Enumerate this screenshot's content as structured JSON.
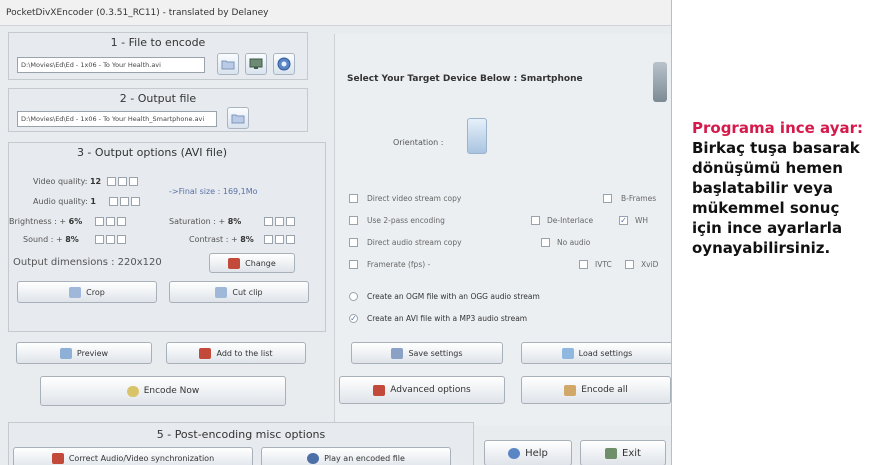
{
  "window": {
    "title": "PocketDivXEncoder (0.3.51_RC11) - translated by Delaney"
  },
  "file_to_encode": {
    "title": "1 - File to encode",
    "path": "D:\\Movies\\Ed\\Ed - 1x06 - To Your Health.avi"
  },
  "output_file": {
    "title": "2 - Output file",
    "path": "D:\\Movies\\Ed\\Ed - 1x06 - To Your Health_Smartphone.avi"
  },
  "output_options": {
    "title": "3 - Output options (AVI file)",
    "video_quality": {
      "label": "Video quality:",
      "value": "12"
    },
    "audio_quality": {
      "label": "Audio quality:",
      "value": "1"
    },
    "final_size": "->Final size : 169,1Mo",
    "brightness": {
      "label": "Brightness : +",
      "value": "6%"
    },
    "saturation": {
      "label": "Saturation : +",
      "value": "8%"
    },
    "sound": {
      "label": "Sound : +",
      "value": "8%"
    },
    "contrast": {
      "label": "Contrast : +",
      "value": "8%"
    },
    "dimensions": "Output dimensions : 220x120",
    "change_label": "Change",
    "crop_label": "Crop",
    "cut_clip_label": "Cut clip"
  },
  "actions": {
    "preview": "Preview",
    "add_to_list": "Add to the list",
    "encode_now": "Encode Now"
  },
  "device": {
    "heading": "Select Your Target Device Below : Smartphone",
    "orientation_label": "Orientation :",
    "options": {
      "direct_video": "Direct video stream copy",
      "bframes": "B-Frames",
      "two_pass": "Use 2-pass encoding",
      "deinterlace": "De-Interlace",
      "wmv": "WH",
      "direct_audio": "Direct audio stream copy",
      "no_audio": "No audio",
      "framerate": "Framerate (fps) -",
      "ivtc": "IVTC",
      "xvid": "XviD",
      "ogm": "Create an OGM file with an OGG audio stream",
      "avi": "Create an AVI file with a MP3 audio stream"
    },
    "save_settings": "Save settings",
    "load_settings": "Load settings",
    "advanced_options": "Advanced options",
    "encode_all": "Encode all"
  },
  "post_encoding": {
    "title": "5 - Post-encoding misc options",
    "correct_sync": "Correct Audio/Video synchronization",
    "play_encoded": "Play an encoded file"
  },
  "footer": {
    "help": "Help",
    "exit": "Exit"
  },
  "caption": {
    "head": "Programa ince ayar:",
    "body": "Birkaç tuşa basarak dönüşümü hemen başlatabilir veya mükemmel sonuç için ince ayarlarla oynayabilirsiniz."
  },
  "colors": {
    "caption_head": "#d6194b",
    "panel": "#e9ecef"
  }
}
